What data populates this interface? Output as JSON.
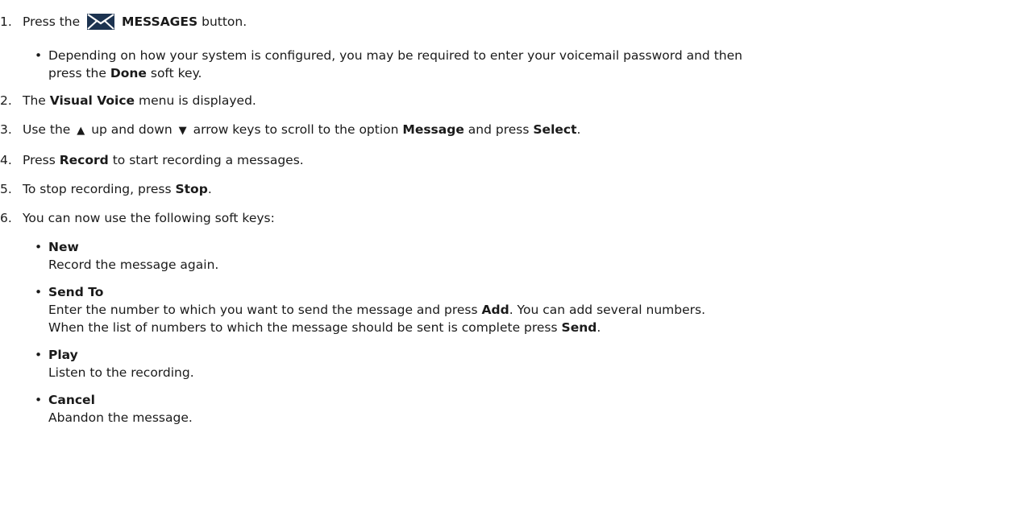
{
  "steps": [
    {
      "num": "1.",
      "a": "Press the",
      "b": "MESSAGES",
      "c": "button."
    },
    {
      "num": "2.",
      "a": "The",
      "b": "Visual Voice",
      "c": "menu is displayed."
    },
    {
      "num": "3.",
      "a": "Use the",
      "b": "up and down",
      "c": "arrow keys to scroll to the option",
      "d": "Message",
      "e": "and press",
      "f": "Select",
      "g": "."
    },
    {
      "num": "4.",
      "a": "Press",
      "b": "Record",
      "c": "to start recording a messages."
    },
    {
      "num": "5.",
      "a": "To stop recording, press",
      "b": "Stop",
      "c": "."
    },
    {
      "num": "6.",
      "a": "You can now use the following soft keys:"
    }
  ],
  "step1_note": {
    "a": "Depending on how your system is configured, you may be required to enter your voicemail password and then",
    "b": "press the",
    "c": "Done",
    "d": "soft key."
  },
  "icons": {
    "envelope": "envelope-icon",
    "up": "up-arrow-icon",
    "down": "down-arrow-icon"
  },
  "softkeys": [
    {
      "name": "New",
      "desc": "Record the message again."
    },
    {
      "name": "Send To",
      "desc_a": "Enter the number to which you want to send the message and press",
      "desc_b": "Add",
      "desc_c": ". You can add several numbers.",
      "desc_d": "When the list of numbers to which the message should be sent is complete press",
      "desc_e": "Send",
      "desc_f": "."
    },
    {
      "name": "Play",
      "desc": "Listen to the recording."
    },
    {
      "name": "Cancel",
      "desc": "Abandon the message."
    }
  ]
}
